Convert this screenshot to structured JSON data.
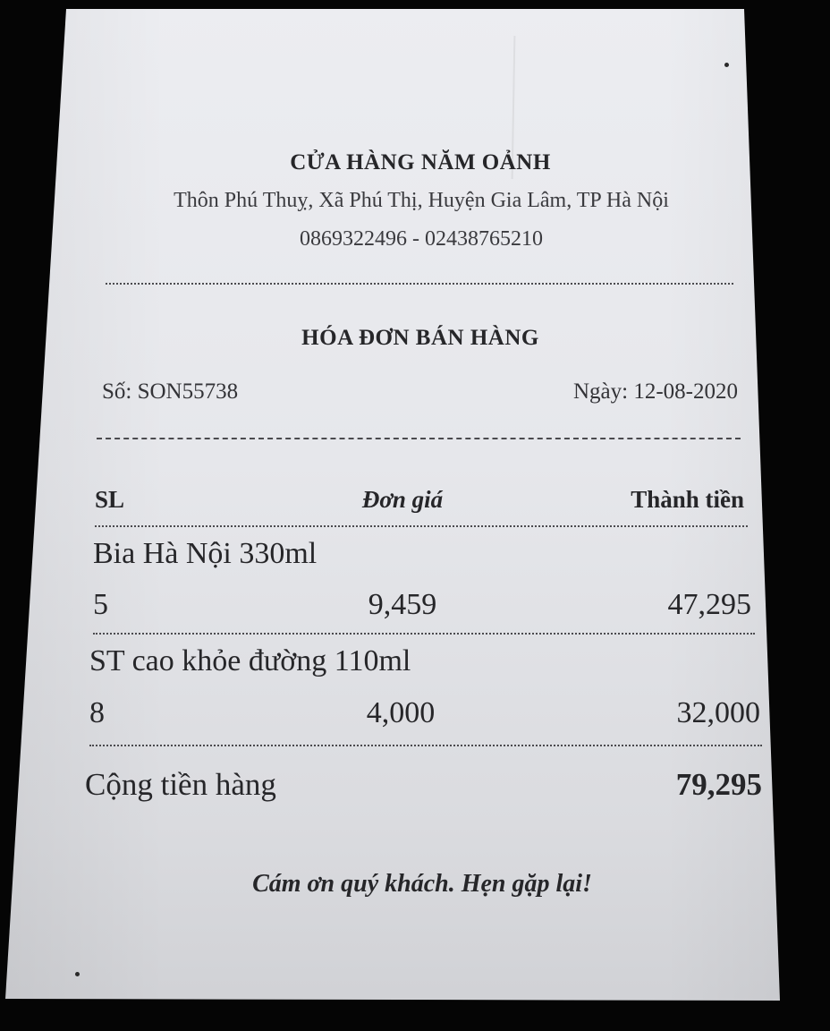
{
  "store": {
    "name": "CỬA HÀNG NĂM OẢNH",
    "address": "Thôn Phú Thuỵ, Xã Phú Thị, Huyện Gia Lâm, TP Hà Nội",
    "phones": "0869322496 - 02438765210"
  },
  "invoice": {
    "title": "HÓA ĐƠN BÁN HÀNG",
    "number": "Số: SON55738",
    "date": "Ngày: 12-08-2020"
  },
  "columns": {
    "qty": "SL",
    "unit_price": "Đơn giá",
    "amount": "Thành tiền"
  },
  "items": [
    {
      "name": "Bia Hà Nội 330ml",
      "qty": "5",
      "unit_price": "9,459",
      "amount": "47,295"
    },
    {
      "name": "ST cao khỏe đường 110ml",
      "qty": "8",
      "unit_price": "4,000",
      "amount": "32,000"
    }
  ],
  "total": {
    "label": "Cộng tiền hàng",
    "value": "79,295"
  },
  "footer": {
    "thanks": "Cám ơn quý khách. Hẹn gặp lại!"
  }
}
